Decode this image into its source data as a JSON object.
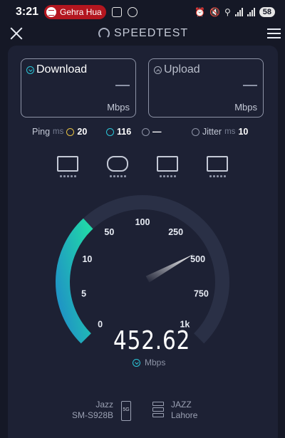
{
  "status_bar": {
    "time": "3:21",
    "media_title": "Gehra Hua",
    "battery": "58"
  },
  "app_bar": {
    "brand": "SPEEDTEST",
    "close_icon": "close-icon",
    "menu_icon": "hamburger-menu-icon"
  },
  "results": {
    "download": {
      "label": "Download",
      "value": "—",
      "unit": "Mbps"
    },
    "upload": {
      "label": "Upload",
      "value": "—",
      "unit": "Mbps"
    }
  },
  "metrics": {
    "ping_label": "Ping",
    "ping_unit": "ms",
    "ping_idle": "20",
    "ping_download": "116",
    "ping_upload": "—",
    "jitter_label": "Jitter",
    "jitter_unit": "ms",
    "jitter_value": "10"
  },
  "categories": [
    {
      "icon": "web-browsing-icon"
    },
    {
      "icon": "gaming-icon"
    },
    {
      "icon": "video-streaming-icon"
    },
    {
      "icon": "video-call-icon"
    }
  ],
  "gauge": {
    "scale_labels": [
      "0",
      "5",
      "10",
      "50",
      "100",
      "250",
      "500",
      "750",
      "1k"
    ],
    "current_value": "452.62",
    "unit": "Mbps",
    "fill_fraction": 0.62,
    "colors": {
      "start": "#1f8fc7",
      "end": "#21d8a8",
      "track": "#2a3046"
    }
  },
  "connection": {
    "provider": "Jazz",
    "device": "SM-S928B",
    "network_type": "5G",
    "server": "JAZZ",
    "server_location": "Lahore"
  }
}
